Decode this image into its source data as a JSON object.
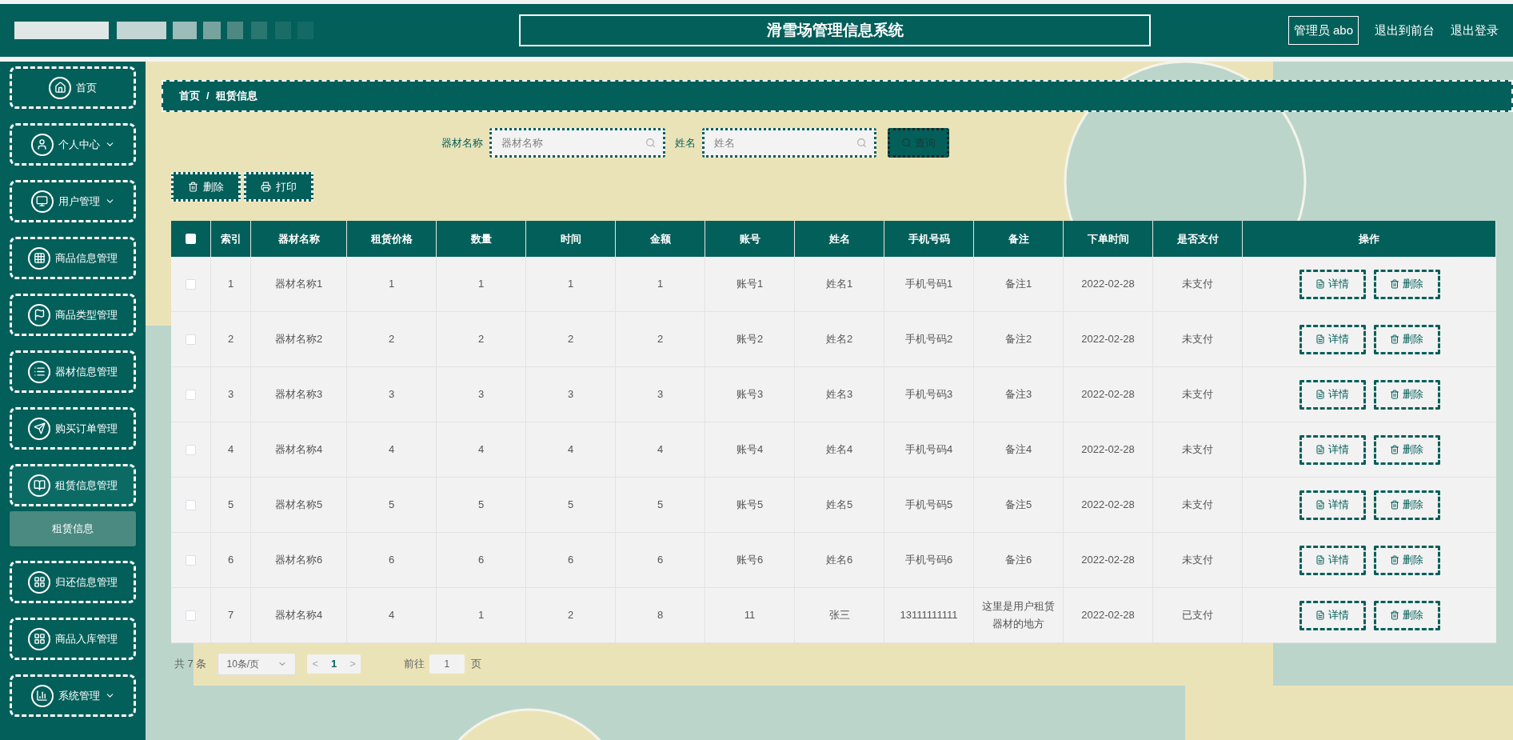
{
  "header": {
    "title": "滑雪场管理信息系统",
    "user": "管理员 abo",
    "links": [
      "退出到前台",
      "退出登录"
    ]
  },
  "sidebar": {
    "items": [
      {
        "label": "首页",
        "expandable": false,
        "expanded": false
      },
      {
        "label": "个人中心",
        "expandable": true,
        "expanded": false
      },
      {
        "label": "用户管理",
        "expandable": true,
        "expanded": false
      },
      {
        "label": "商品信息管理",
        "expandable": false,
        "expanded": false
      },
      {
        "label": "商品类型管理",
        "expandable": false,
        "expanded": false
      },
      {
        "label": "器材信息管理",
        "expandable": false,
        "expanded": false
      },
      {
        "label": "购买订单管理",
        "expandable": false,
        "expanded": false
      },
      {
        "label": "租赁信息管理",
        "expandable": false,
        "expanded": true,
        "children": [
          {
            "label": "租赁信息",
            "selected": true
          }
        ]
      },
      {
        "label": "归还信息管理",
        "expandable": false,
        "expanded": false
      },
      {
        "label": "商品入库管理",
        "expandable": false,
        "expanded": false
      },
      {
        "label": "系统管理",
        "expandable": true,
        "expanded": false
      }
    ]
  },
  "breadcrumb": [
    "首页",
    "/",
    "租赁信息"
  ],
  "search": {
    "fields": [
      {
        "label": "器材名称",
        "placeholder": "器材名称"
      },
      {
        "label": "姓名",
        "placeholder": "姓名"
      }
    ],
    "button": "查询"
  },
  "actions": [
    {
      "label": "删除"
    },
    {
      "label": "打印"
    }
  ],
  "table": {
    "all_checked": false,
    "columns": [
      "索引",
      "器材名称",
      "租赁价格",
      "数量",
      "时间",
      "金额",
      "账号",
      "姓名",
      "手机号码",
      "备注",
      "下单时间",
      "是否支付",
      "操作"
    ],
    "rows": [
      {
        "checked": false,
        "cells": [
          "1",
          "器材名称1",
          "1",
          "1",
          "1",
          "1",
          "账号1",
          "姓名1",
          "手机号码1",
          "备注1",
          "2022-02-28",
          "未支付"
        ],
        "actions": [
          "详情",
          "删除"
        ]
      },
      {
        "checked": false,
        "cells": [
          "2",
          "器材名称2",
          "2",
          "2",
          "2",
          "2",
          "账号2",
          "姓名2",
          "手机号码2",
          "备注2",
          "2022-02-28",
          "未支付"
        ],
        "actions": [
          "详情",
          "删除"
        ]
      },
      {
        "checked": false,
        "cells": [
          "3",
          "器材名称3",
          "3",
          "3",
          "3",
          "3",
          "账号3",
          "姓名3",
          "手机号码3",
          "备注3",
          "2022-02-28",
          "未支付"
        ],
        "actions": [
          "详情",
          "删除"
        ]
      },
      {
        "checked": false,
        "cells": [
          "4",
          "器材名称4",
          "4",
          "4",
          "4",
          "4",
          "账号4",
          "姓名4",
          "手机号码4",
          "备注4",
          "2022-02-28",
          "未支付"
        ],
        "actions": [
          "详情",
          "删除"
        ]
      },
      {
        "checked": false,
        "cells": [
          "5",
          "器材名称5",
          "5",
          "5",
          "5",
          "5",
          "账号5",
          "姓名5",
          "手机号码5",
          "备注5",
          "2022-02-28",
          "未支付"
        ],
        "actions": [
          "详情",
          "删除"
        ]
      },
      {
        "checked": false,
        "cells": [
          "6",
          "器材名称6",
          "6",
          "6",
          "6",
          "6",
          "账号6",
          "姓名6",
          "手机号码6",
          "备注6",
          "2022-02-28",
          "未支付"
        ],
        "actions": [
          "详情",
          "删除"
        ]
      },
      {
        "checked": false,
        "cells": [
          "7",
          "器材名称4",
          "4",
          "1",
          "2",
          "8",
          "11",
          "张三",
          "13111111111",
          "这里是用户租赁器材的地方",
          "2022-02-28",
          "已支付"
        ],
        "actions": [
          "详情",
          "删除"
        ]
      }
    ]
  },
  "pagination": {
    "total": "共 7 条",
    "page_size": "10条/页",
    "prev": "<",
    "page": "1",
    "next": ">",
    "goto_label": "前往",
    "goto_value": "1",
    "goto_suffix": "页"
  }
}
